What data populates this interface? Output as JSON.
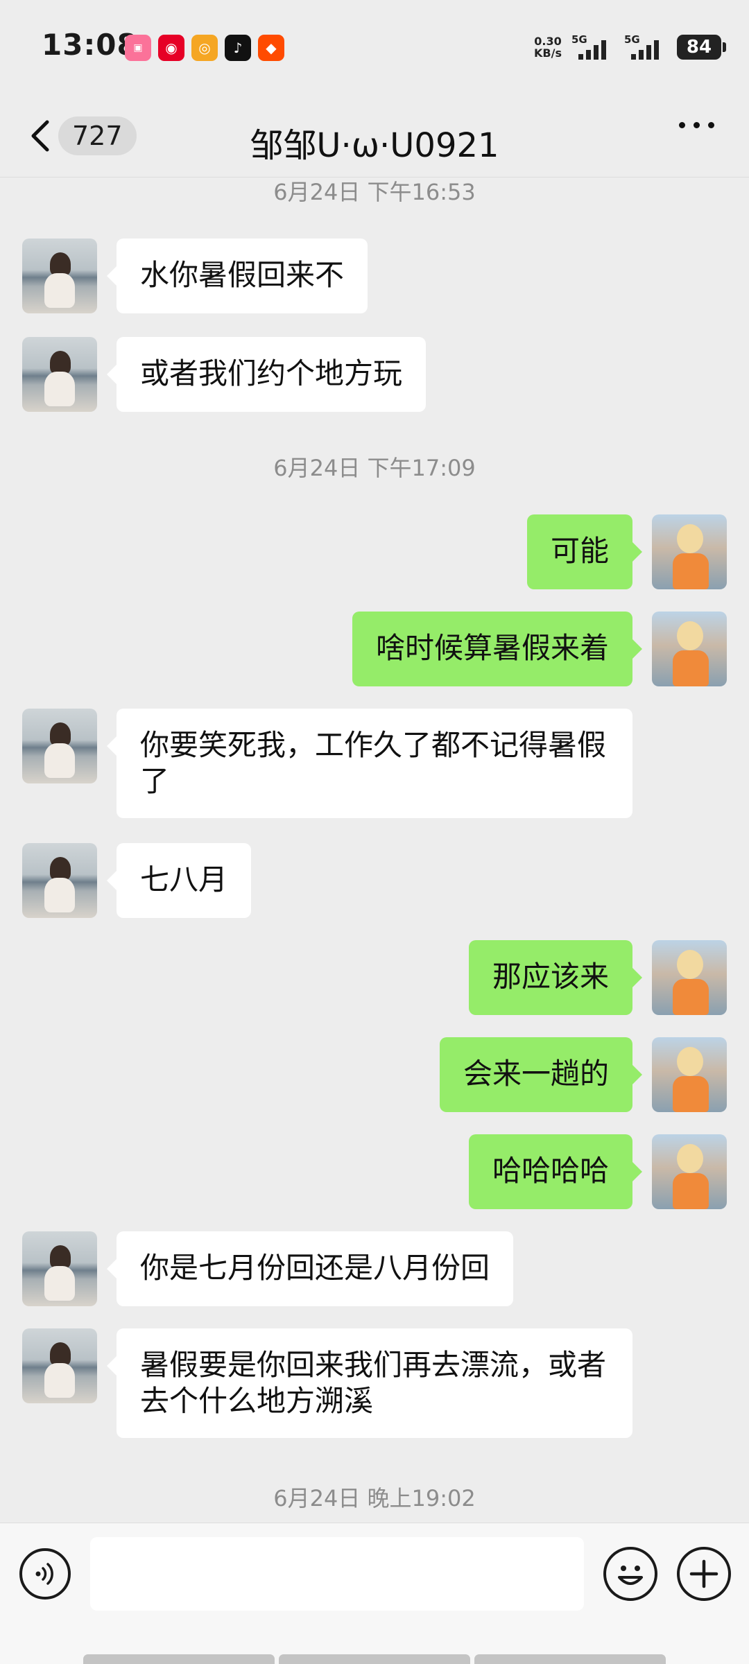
{
  "status_bar": {
    "time": "13:08",
    "apps": [
      "bilibili",
      "netease-music",
      "weibo",
      "tiktok",
      "taobao"
    ],
    "net_speed_value": "0.30",
    "net_speed_unit": "KB/s",
    "sim1_label": "5G",
    "sim2_label": "5G",
    "battery": "84"
  },
  "nav": {
    "unread_count": "727",
    "title": "邹邹U·ω·U0921"
  },
  "messages": [
    {
      "type": "time",
      "text": "6月24日 下午16:53"
    },
    {
      "type": "msg",
      "side": "left",
      "text": "水你暑假回来不"
    },
    {
      "type": "msg",
      "side": "left",
      "text": "或者我们约个地方玩"
    },
    {
      "type": "time",
      "text": "6月24日 下午17:09"
    },
    {
      "type": "msg",
      "side": "right",
      "text": "可能"
    },
    {
      "type": "msg",
      "side": "right",
      "text": "啥时候算暑假来着"
    },
    {
      "type": "msg",
      "side": "left",
      "text": "你要笑死我，工作久了都不记得暑假了"
    },
    {
      "type": "msg",
      "side": "left",
      "text": "七八月"
    },
    {
      "type": "msg",
      "side": "right",
      "text": "那应该来"
    },
    {
      "type": "msg",
      "side": "right",
      "text": "会来一趟的"
    },
    {
      "type": "msg",
      "side": "right",
      "text": "哈哈哈哈"
    },
    {
      "type": "msg",
      "side": "left",
      "text": "你是七月份回还是八月份回"
    },
    {
      "type": "msg",
      "side": "left",
      "text": "暑假要是你回来我们再去漂流，或者去个什么地方溯溪"
    },
    {
      "type": "time",
      "text": "6月24日 晚上19:02"
    }
  ],
  "input": {
    "value": ""
  },
  "colors": {
    "background": "#ededed",
    "sent_bubble": "#95ec69",
    "received_bubble": "#ffffff",
    "timestamp": "#8c8c8c"
  }
}
